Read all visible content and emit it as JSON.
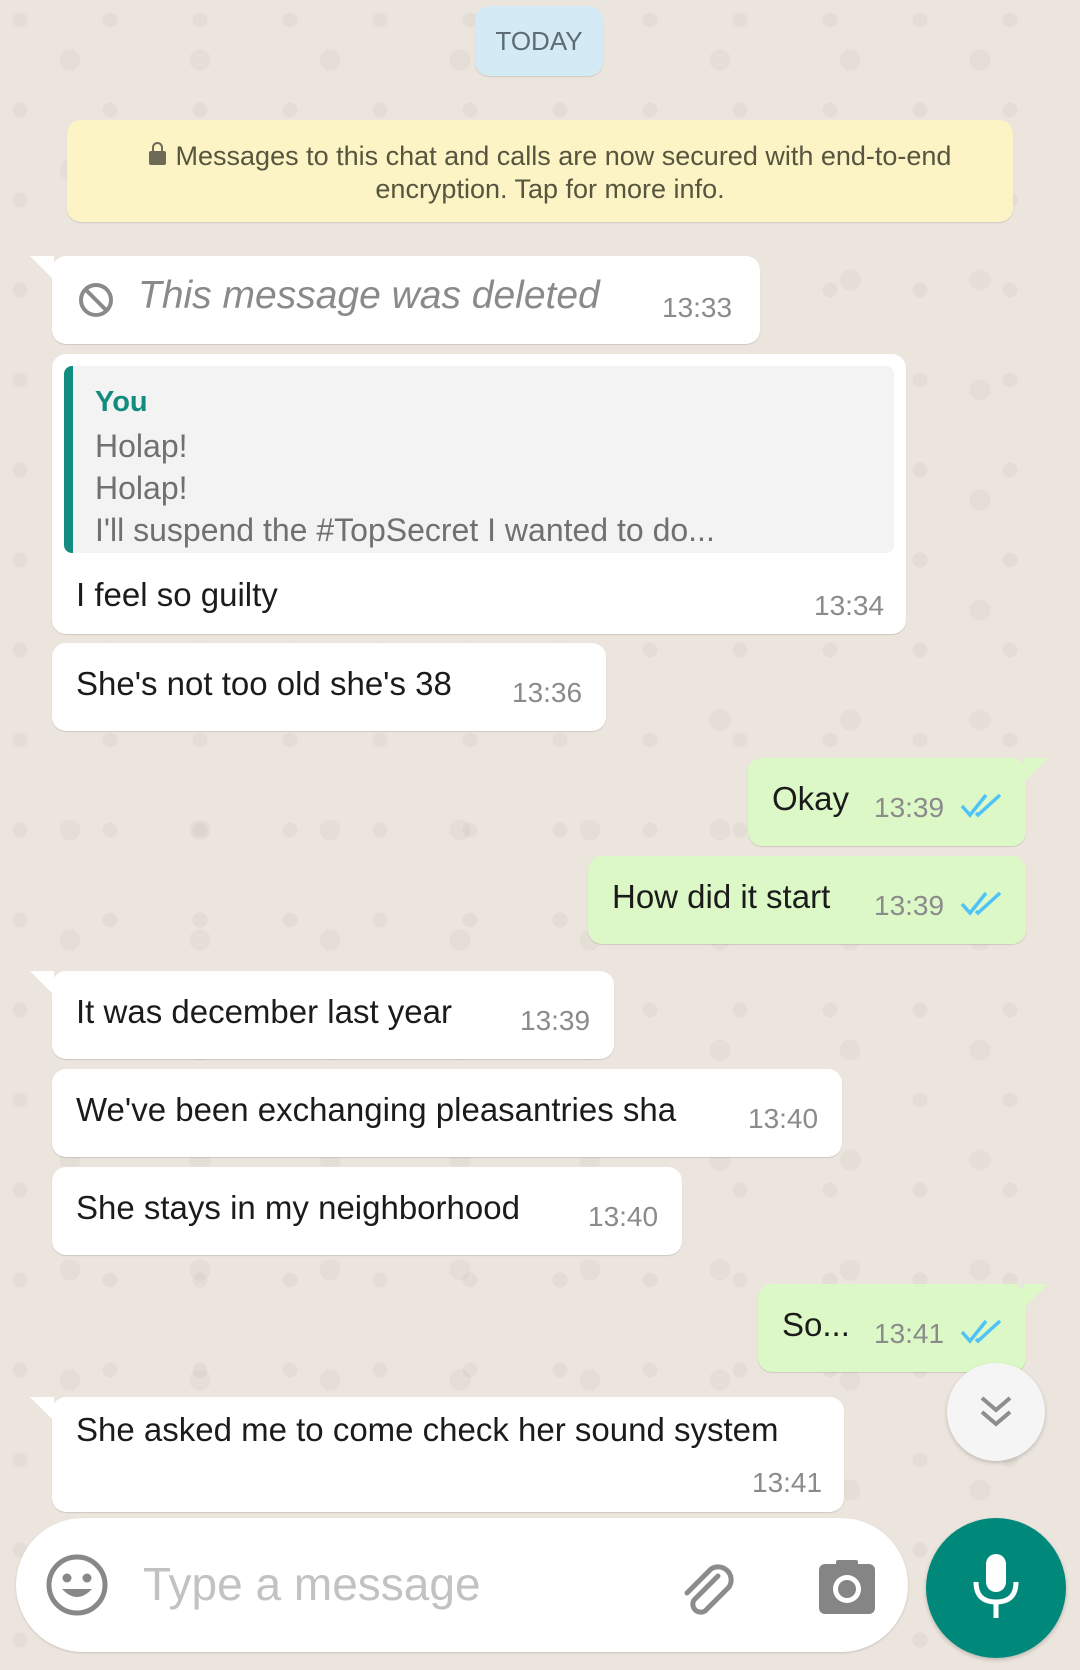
{
  "chat": {
    "date_label": "TODAY",
    "encryption_notice": {
      "line1": "Messages to this chat and calls are now secured with end-to-end",
      "line2": "encryption. Tap for more info."
    },
    "messages": [
      {
        "direction": "in",
        "type": "deleted",
        "text": "This message was deleted",
        "time": "13:33"
      },
      {
        "direction": "in",
        "type": "reply",
        "quote_author": "You",
        "quote_lines": [
          "Holap!",
          "Holap!",
          "I'll suspend the #TopSecret I wanted to do..."
        ],
        "text": "I feel so guilty",
        "time": "13:34"
      },
      {
        "direction": "in",
        "text": "She's not too old she's 38",
        "time": "13:36"
      },
      {
        "direction": "out",
        "text": "Okay",
        "time": "13:39",
        "status": "read"
      },
      {
        "direction": "out",
        "text": "How did it start",
        "time": "13:39",
        "status": "read"
      },
      {
        "direction": "in",
        "text": "It was december last year",
        "time": "13:39"
      },
      {
        "direction": "in",
        "text": "We've been exchanging pleasantries sha",
        "time": "13:40"
      },
      {
        "direction": "in",
        "text": "She stays in my neighborhood",
        "time": "13:40"
      },
      {
        "direction": "out",
        "text": "So...",
        "time": "13:41",
        "status": "read"
      },
      {
        "direction": "in",
        "text": "She asked me to come check her sound system",
        "time": "13:41"
      }
    ]
  },
  "composer": {
    "placeholder": "Type a message"
  },
  "icons": {
    "emoji": "emoji-icon",
    "attach": "paperclip-icon",
    "camera": "camera-icon",
    "mic": "microphone-icon",
    "scroll_down": "double-chevron-down-icon",
    "deleted": "ban-icon",
    "lock": "lock-icon",
    "read_ticks": "double-check-icon"
  },
  "colors": {
    "incoming_bubble": "#ffffff",
    "outgoing_bubble": "#dcf8c6",
    "read_ticks": "#4fc3f7",
    "accent": "#128c7e",
    "fab": "#00897b",
    "wallpaper": "#ece5dd"
  }
}
